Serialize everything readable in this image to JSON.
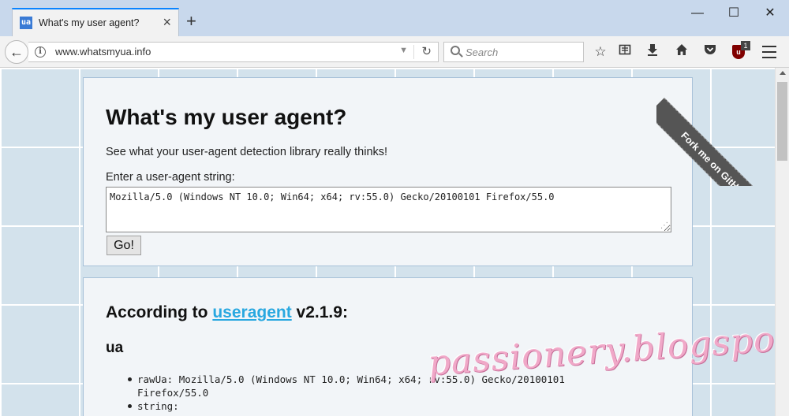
{
  "browser": {
    "tab": {
      "favicon": "ua",
      "title": "What's my user agent?"
    },
    "window_controls": {
      "minimize": "—",
      "maximize": "☐",
      "close": "✕"
    },
    "url": "www.whatsmyua.info",
    "search_placeholder": "Search",
    "ublock_badge": "1"
  },
  "page": {
    "heading": "What's my user agent?",
    "subheading": "See what your user-agent detection library really thinks!",
    "input_label": "Enter a user-agent string:",
    "ua_string": "Mozilla/5.0 (Windows NT 10.0; Win64; x64; rv:55.0) Gecko/20100101 Firefox/55.0",
    "go_label": "Go!",
    "according_prefix": "According to ",
    "library_link": "useragent",
    "library_version": " v2.1.9:",
    "section_title": "ua",
    "items": [
      {
        "key": "rawUa: ",
        "value": "Mozilla/5.0 (Windows NT 10.0; Win64; x64; rv:55.0) Gecko/20100101 Firefox/55.0"
      },
      {
        "key": "string:",
        "value": ""
      }
    ],
    "ribbon": "Fork me on GitHub",
    "watermark": "passionery.blogspot.com"
  }
}
